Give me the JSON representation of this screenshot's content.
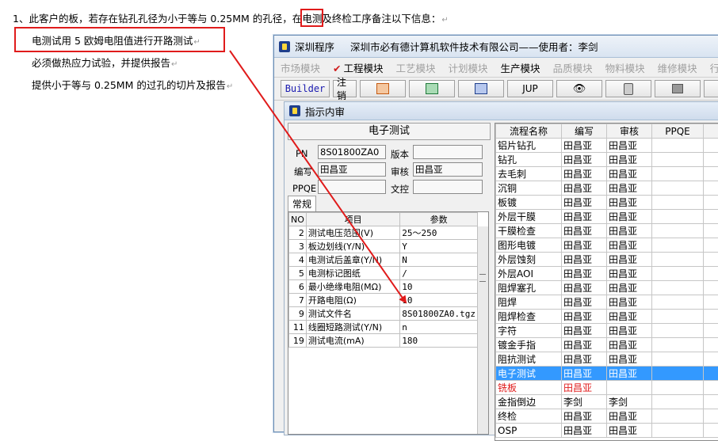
{
  "document": {
    "line1_number": "1、",
    "line1_before": "此客户的板，若存在钻孔孔径为小于等与 0.25MM 的孔径，在",
    "line1_boxed": "电测",
    "line1_after": "及终检工序备注以下信息：",
    "line2": "电测试用 5 欧姆电阻值进行开路测试",
    "line3": "必须做热应力试验，并提供报告",
    "line4": "提供小于等与 0.25MM 的过孔的切片及报告",
    "para_mark": "↵"
  },
  "window": {
    "title_app": "深圳程序",
    "title_company": "深圳市必有德计算机软件技术有限公司——使用者：李剑",
    "menus": [
      "市场模块",
      "工程模块",
      "工艺模块",
      "计划模块",
      "生产模块",
      "品质模块",
      "物料模块",
      "维修模块",
      "行政模"
    ],
    "active_menus": [
      "工程模块",
      "生产模块"
    ],
    "toolbar": {
      "builder": "Builder",
      "cancel": "注销",
      "jup": "JUP"
    }
  },
  "subwindow": {
    "title": "指示内审",
    "section_title": "电子测试",
    "fields": {
      "pn_label": "PN",
      "pn_value": "8S01800ZA0",
      "version_label": "版本",
      "version_value": "",
      "author_label": "编写",
      "author_value": "田昌亚",
      "review_label": "审核",
      "review_value": "田昌亚",
      "ppqe_label": "PPQE",
      "ppqe_value": "",
      "doc_control_label": "文控",
      "doc_control_value": ""
    },
    "tab_label": "常规",
    "param_table": {
      "headers": [
        "NO",
        "项目",
        "参数"
      ],
      "rows": [
        {
          "no": "2",
          "item": "测试电压范围(V)",
          "value": "25～250"
        },
        {
          "no": "3",
          "item": "板边划线(Y/N)",
          "value": "Y"
        },
        {
          "no": "4",
          "item": "电测试后盖章(Y/N)",
          "value": "N"
        },
        {
          "no": "5",
          "item": "电测标记图纸",
          "value": "/"
        },
        {
          "no": "6",
          "item": "最小绝缘电阻(MΩ)",
          "value": "10"
        },
        {
          "no": "7",
          "item": "开路电阻(Ω)",
          "value": "10"
        },
        {
          "no": "9",
          "item": "测试文件名",
          "value": "8S01800ZA0.tgz"
        },
        {
          "no": "11",
          "item": "线圈短路测试(Y/N)",
          "value": "n"
        },
        {
          "no": "19",
          "item": "测试电流(mA)",
          "value": "180"
        }
      ]
    },
    "process_table": {
      "headers": [
        "流程名称",
        "编写",
        "审核",
        "PPQE",
        "F"
      ],
      "rows": [
        {
          "name": "铝片钻孔",
          "author": "田昌亚",
          "review": "田昌亚",
          "state": "normal"
        },
        {
          "name": "钻孔",
          "author": "田昌亚",
          "review": "田昌亚",
          "state": "normal"
        },
        {
          "name": "去毛刺",
          "author": "田昌亚",
          "review": "田昌亚",
          "state": "normal"
        },
        {
          "name": "沉铜",
          "author": "田昌亚",
          "review": "田昌亚",
          "state": "normal"
        },
        {
          "name": "板镀",
          "author": "田昌亚",
          "review": "田昌亚",
          "state": "normal"
        },
        {
          "name": "外层干膜",
          "author": "田昌亚",
          "review": "田昌亚",
          "state": "normal"
        },
        {
          "name": "干膜检查",
          "author": "田昌亚",
          "review": "田昌亚",
          "state": "normal"
        },
        {
          "name": "图形电镀",
          "author": "田昌亚",
          "review": "田昌亚",
          "state": "normal"
        },
        {
          "name": "外层蚀刻",
          "author": "田昌亚",
          "review": "田昌亚",
          "state": "normal"
        },
        {
          "name": "外层AOI",
          "author": "田昌亚",
          "review": "田昌亚",
          "state": "normal"
        },
        {
          "name": "阻焊塞孔",
          "author": "田昌亚",
          "review": "田昌亚",
          "state": "normal"
        },
        {
          "name": "阻焊",
          "author": "田昌亚",
          "review": "田昌亚",
          "state": "normal"
        },
        {
          "name": "阻焊检查",
          "author": "田昌亚",
          "review": "田昌亚",
          "state": "normal"
        },
        {
          "name": "字符",
          "author": "田昌亚",
          "review": "田昌亚",
          "state": "normal"
        },
        {
          "name": "镀金手指",
          "author": "田昌亚",
          "review": "田昌亚",
          "state": "normal"
        },
        {
          "name": "阻抗测试",
          "author": "田昌亚",
          "review": "田昌亚",
          "state": "normal"
        },
        {
          "name": "电子测试",
          "author": "田昌亚",
          "review": "田昌亚",
          "state": "selected"
        },
        {
          "name": "铣板",
          "author": "田昌亚",
          "review": "",
          "state": "red"
        },
        {
          "name": "金指倒边",
          "author": "李剑",
          "review": "李剑",
          "state": "normal"
        },
        {
          "name": "终检",
          "author": "田昌亚",
          "review": "田昌亚",
          "state": "normal"
        },
        {
          "name": "OSP",
          "author": "田昌亚",
          "review": "田昌亚",
          "state": "normal"
        }
      ]
    }
  },
  "colors": {
    "highlight": "#e01b1b",
    "selection": "#3399ff"
  }
}
